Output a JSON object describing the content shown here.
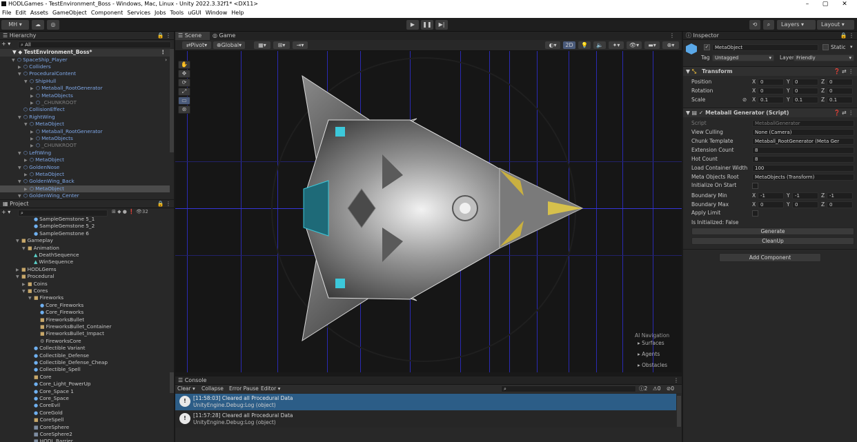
{
  "window": {
    "title": "HODLGames - TestEnvironment_Boss - Windows, Mac, Linux - Unity 2022.3.32f1* <DX11>",
    "min": "–",
    "max": "▢",
    "close": "✕"
  },
  "menu": [
    "File",
    "Edit",
    "Assets",
    "GameObject",
    "Component",
    "Services",
    "Jobs",
    "Tools",
    "uGUI",
    "Window",
    "Help"
  ],
  "toolbar": {
    "account": "MH ▾",
    "layers": "Layers",
    "layout": "Layout"
  },
  "hierarchy": {
    "title": "Hierarchy",
    "search": "All",
    "scene": "TestEnvironment_Boss*",
    "items": [
      {
        "t": "SpaceShip_Player",
        "d": 1,
        "c": "blue",
        "f": "▼"
      },
      {
        "t": "Colliders",
        "d": 2,
        "c": "blue",
        "f": "▶"
      },
      {
        "t": "ProceduralContent",
        "d": 2,
        "c": "blue",
        "f": "▼"
      },
      {
        "t": "ShipHull",
        "d": 3,
        "c": "blue",
        "f": "▼"
      },
      {
        "t": "Metaball_RootGenerator",
        "d": 4,
        "c": "blue",
        "f": "▶"
      },
      {
        "t": "MetaObjects",
        "d": 4,
        "c": "blue",
        "f": "▶"
      },
      {
        "t": "_CHUNKROOT",
        "d": 4,
        "c": "gray",
        "f": "▶"
      },
      {
        "t": "CollisionEffect",
        "d": 2,
        "c": "blue",
        "f": ""
      },
      {
        "t": "RightWing",
        "d": 2,
        "c": "blue",
        "f": "▼"
      },
      {
        "t": "MetaObject",
        "d": 3,
        "c": "blue",
        "f": "▼"
      },
      {
        "t": "Metaball_RootGenerator",
        "d": 4,
        "c": "blue",
        "f": "▶"
      },
      {
        "t": "MetaObjects",
        "d": 4,
        "c": "blue",
        "f": "▶"
      },
      {
        "t": "_CHUNKROOT",
        "d": 4,
        "c": "gray",
        "f": "▶"
      },
      {
        "t": "LeftWing",
        "d": 2,
        "c": "blue",
        "f": "▼"
      },
      {
        "t": "MetaObject",
        "d": 3,
        "c": "blue",
        "f": "▶"
      },
      {
        "t": "GoldenNose",
        "d": 2,
        "c": "blue",
        "f": "▼"
      },
      {
        "t": "MetaObject",
        "d": 3,
        "c": "blue",
        "f": "▶"
      },
      {
        "t": "GoldenWing_Back",
        "d": 2,
        "c": "blue",
        "f": "▼"
      },
      {
        "t": "MetaObject",
        "d": 3,
        "c": "blue",
        "f": "▶",
        "sel": true
      },
      {
        "t": "GoldenWing_Center",
        "d": 2,
        "c": "blue",
        "f": "▼"
      }
    ]
  },
  "project": {
    "title": "Project",
    "count": "32",
    "items": [
      {
        "t": "SampleGemstone 5_1",
        "d": 3,
        "i": "●"
      },
      {
        "t": "SampleGemstone 5_2",
        "d": 3,
        "i": "●"
      },
      {
        "t": "SampleGemstone 6",
        "d": 3,
        "i": "●"
      },
      {
        "t": "Gameplay",
        "d": 1,
        "i": "■",
        "f": "▼"
      },
      {
        "t": "Animation",
        "d": 2,
        "i": "■",
        "f": "▼"
      },
      {
        "t": "DeathSequence",
        "d": 3,
        "i": "▲"
      },
      {
        "t": "WinSequence",
        "d": 3,
        "i": "▲"
      },
      {
        "t": "HODLGems",
        "d": 1,
        "i": "■",
        "f": "▶"
      },
      {
        "t": "Procedural",
        "d": 1,
        "i": "■",
        "f": "▼"
      },
      {
        "t": "Coins",
        "d": 2,
        "i": "■",
        "f": "▶"
      },
      {
        "t": "Cores",
        "d": 2,
        "i": "■",
        "f": "▼"
      },
      {
        "t": "Fireworks",
        "d": 3,
        "i": "■",
        "f": "▼"
      },
      {
        "t": "Core_Fireworks",
        "d": 4,
        "i": "●"
      },
      {
        "t": "Core_Fireworks",
        "d": 4,
        "i": "●"
      },
      {
        "t": "FireworksBullet",
        "d": 4,
        "i": "■"
      },
      {
        "t": "FireworksBullet_Container",
        "d": 4,
        "i": "■"
      },
      {
        "t": "FireworksBullet_Impact",
        "d": 4,
        "i": "■"
      },
      {
        "t": "FireworksCore",
        "d": 4,
        "i": "⚙"
      },
      {
        "t": "Collectible Variant",
        "d": 3,
        "i": "●"
      },
      {
        "t": "Collectible_Defense",
        "d": 3,
        "i": "●"
      },
      {
        "t": "Collectible_Defense_Cheap",
        "d": 3,
        "i": "●"
      },
      {
        "t": "Collectible_Spell",
        "d": 3,
        "i": "●"
      },
      {
        "t": "Core",
        "d": 3,
        "i": "■"
      },
      {
        "t": "Core_Light_PowerUp",
        "d": 3,
        "i": "●"
      },
      {
        "t": "Core_Space 1",
        "d": 3,
        "i": "●"
      },
      {
        "t": "Core_Space",
        "d": 3,
        "i": "●"
      },
      {
        "t": "CoreEvil",
        "d": 3,
        "i": "●"
      },
      {
        "t": "CoreGold",
        "d": 3,
        "i": "●"
      },
      {
        "t": "CoreSpell",
        "d": 3,
        "i": "■"
      },
      {
        "t": "CoreSphere",
        "d": 3,
        "i": "▦"
      },
      {
        "t": "CoreSphere2",
        "d": 3,
        "i": "▦"
      },
      {
        "t": "HODL Barrier",
        "d": 3,
        "i": "▦"
      }
    ]
  },
  "scene": {
    "tab_scene": "Scene",
    "tab_game": "Game",
    "pivot": "Pivot",
    "global": "Global",
    "mode2d": "2D",
    "nav": {
      "title": "AI Navigation",
      "items": [
        "Surfaces",
        "Agents",
        "Obstacles"
      ]
    }
  },
  "console": {
    "title": "Console",
    "clear": "Clear",
    "collapse": "Collapse",
    "error_pause": "Error Pause",
    "editor": "Editor",
    "counts": {
      "info": "2",
      "warn": "0",
      "err": "0"
    },
    "logs": [
      {
        "time": "[11:58:03] Cleared all Procedural Data",
        "src": "UnityEngine.Debug:Log (object)"
      },
      {
        "time": "[11:57:28] Cleared all Procedural Data",
        "src": "UnityEngine.Debug:Log (object)"
      }
    ]
  },
  "inspector": {
    "title": "Inspector",
    "object": "MetaObject",
    "static": "Static",
    "tag_label": "Tag",
    "tag": "Untagged",
    "layer_label": "Layer",
    "layer": "Friendly",
    "transform": {
      "title": "Transform",
      "position": {
        "label": "Position",
        "x": "0",
        "y": "0",
        "z": "0"
      },
      "rotation": {
        "label": "Rotation",
        "x": "0",
        "y": "0",
        "z": "0"
      },
      "scale": {
        "label": "Scale",
        "x": "0.1",
        "y": "0.1",
        "z": "0.1"
      }
    },
    "script": {
      "title": "Metaball Generator (Script)",
      "rows": [
        {
          "l": "Script",
          "v": "MetaballGenerator",
          "dim": true
        },
        {
          "l": "View Culling",
          "v": "None (Camera)"
        },
        {
          "l": "Chunk Template",
          "v": "Metaball_RootGenerator (Meta Ger"
        },
        {
          "l": "Extension Count",
          "v": "8"
        },
        {
          "l": "Hot Count",
          "v": "8"
        },
        {
          "l": "Load Container Width",
          "v": "100"
        },
        {
          "l": "Meta Objects Root",
          "v": "MetaObjects (Transform)"
        }
      ],
      "init_on_start": "Initialize On Start",
      "bmin": {
        "label": "Boundary Min",
        "x": "-1",
        "y": "-1",
        "z": "-1"
      },
      "bmax": {
        "label": "Boundary Max",
        "x": "0",
        "y": "0",
        "z": "0"
      },
      "apply_limit": "Apply Limit",
      "is_init": "Is Initialized: False",
      "generate": "Generate",
      "cleanup": "CleanUp"
    },
    "add_component": "Add Component"
  }
}
